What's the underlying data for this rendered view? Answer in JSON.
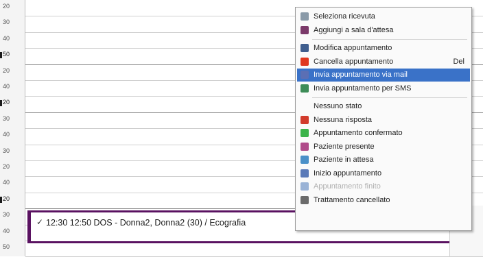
{
  "time_gutter": {
    "ticks": [
      {
        "label": "20",
        "hour": false
      },
      {
        "label": "30",
        "hour": false
      },
      {
        "label": "40",
        "hour": false
      },
      {
        "label": "50",
        "hour": true
      },
      {
        "label": "20",
        "hour": false
      },
      {
        "label": "40",
        "hour": false
      },
      {
        "label": "20",
        "hour": true
      },
      {
        "label": "30",
        "hour": false
      },
      {
        "label": "40",
        "hour": false
      },
      {
        "label": "30",
        "hour": false
      },
      {
        "label": "20",
        "hour": false
      },
      {
        "label": "40",
        "hour": false
      },
      {
        "label": "20",
        "hour": true
      },
      {
        "label": "30",
        "hour": false
      },
      {
        "label": "40",
        "hour": false
      },
      {
        "label": "50",
        "hour": false
      }
    ]
  },
  "appointment": {
    "text": "12:30 12:50 DOS - Donna2, Donna2 (30) / Ecografia"
  },
  "context_menu": {
    "items": [
      {
        "label": "Seleziona ricevuta",
        "shortcut": "",
        "icon": "receipt-icon",
        "color": "#8a9aa8",
        "state": "normal"
      },
      {
        "label": "Aggiungi a sala d'attesa",
        "shortcut": "",
        "icon": "waiting-room-icon",
        "color": "#7b3a6a",
        "state": "normal"
      },
      {
        "sep": true
      },
      {
        "label": "Modifica appuntamento",
        "shortcut": "",
        "icon": "edit-icon",
        "color": "#3f5e8e",
        "state": "normal"
      },
      {
        "label": "Cancella appuntamento",
        "shortcut": "Del",
        "icon": "cancel-icon",
        "color": "#e0381f",
        "state": "normal"
      },
      {
        "label": "Invia appuntamento via mail",
        "shortcut": "",
        "icon": "mail-icon",
        "color": "#5b6fb4",
        "state": "selected"
      },
      {
        "label": "Invia appuntamento per SMS",
        "shortcut": "",
        "icon": "sms-icon",
        "color": "#3d8c57",
        "state": "normal"
      },
      {
        "sep": true
      },
      {
        "label": "Nessuno stato",
        "shortcut": "",
        "icon": "",
        "color": "",
        "state": "normal"
      },
      {
        "label": "Nessuna risposta",
        "shortcut": "",
        "icon": "no-response-icon",
        "color": "#d23b2c",
        "state": "normal"
      },
      {
        "label": "Appuntamento confermato",
        "shortcut": "",
        "icon": "confirmed-icon",
        "color": "#3bb34a",
        "state": "normal"
      },
      {
        "label": "Paziente presente",
        "shortcut": "",
        "icon": "patient-present-icon",
        "color": "#b04b8a",
        "state": "normal"
      },
      {
        "label": "Paziente in attesa",
        "shortcut": "",
        "icon": "patient-waiting-icon",
        "color": "#4a90c8",
        "state": "normal"
      },
      {
        "label": "Inizio appuntamento",
        "shortcut": "",
        "icon": "start-icon",
        "color": "#5a7ab8",
        "state": "normal"
      },
      {
        "label": "Appuntamento finito",
        "shortcut": "",
        "icon": "check-icon",
        "color": "#9ab3d6",
        "state": "disabled"
      },
      {
        "label": "Trattamento cancellato",
        "shortcut": "",
        "icon": "treatment-cancelled-icon",
        "color": "#6b6b6b",
        "state": "normal"
      }
    ]
  }
}
